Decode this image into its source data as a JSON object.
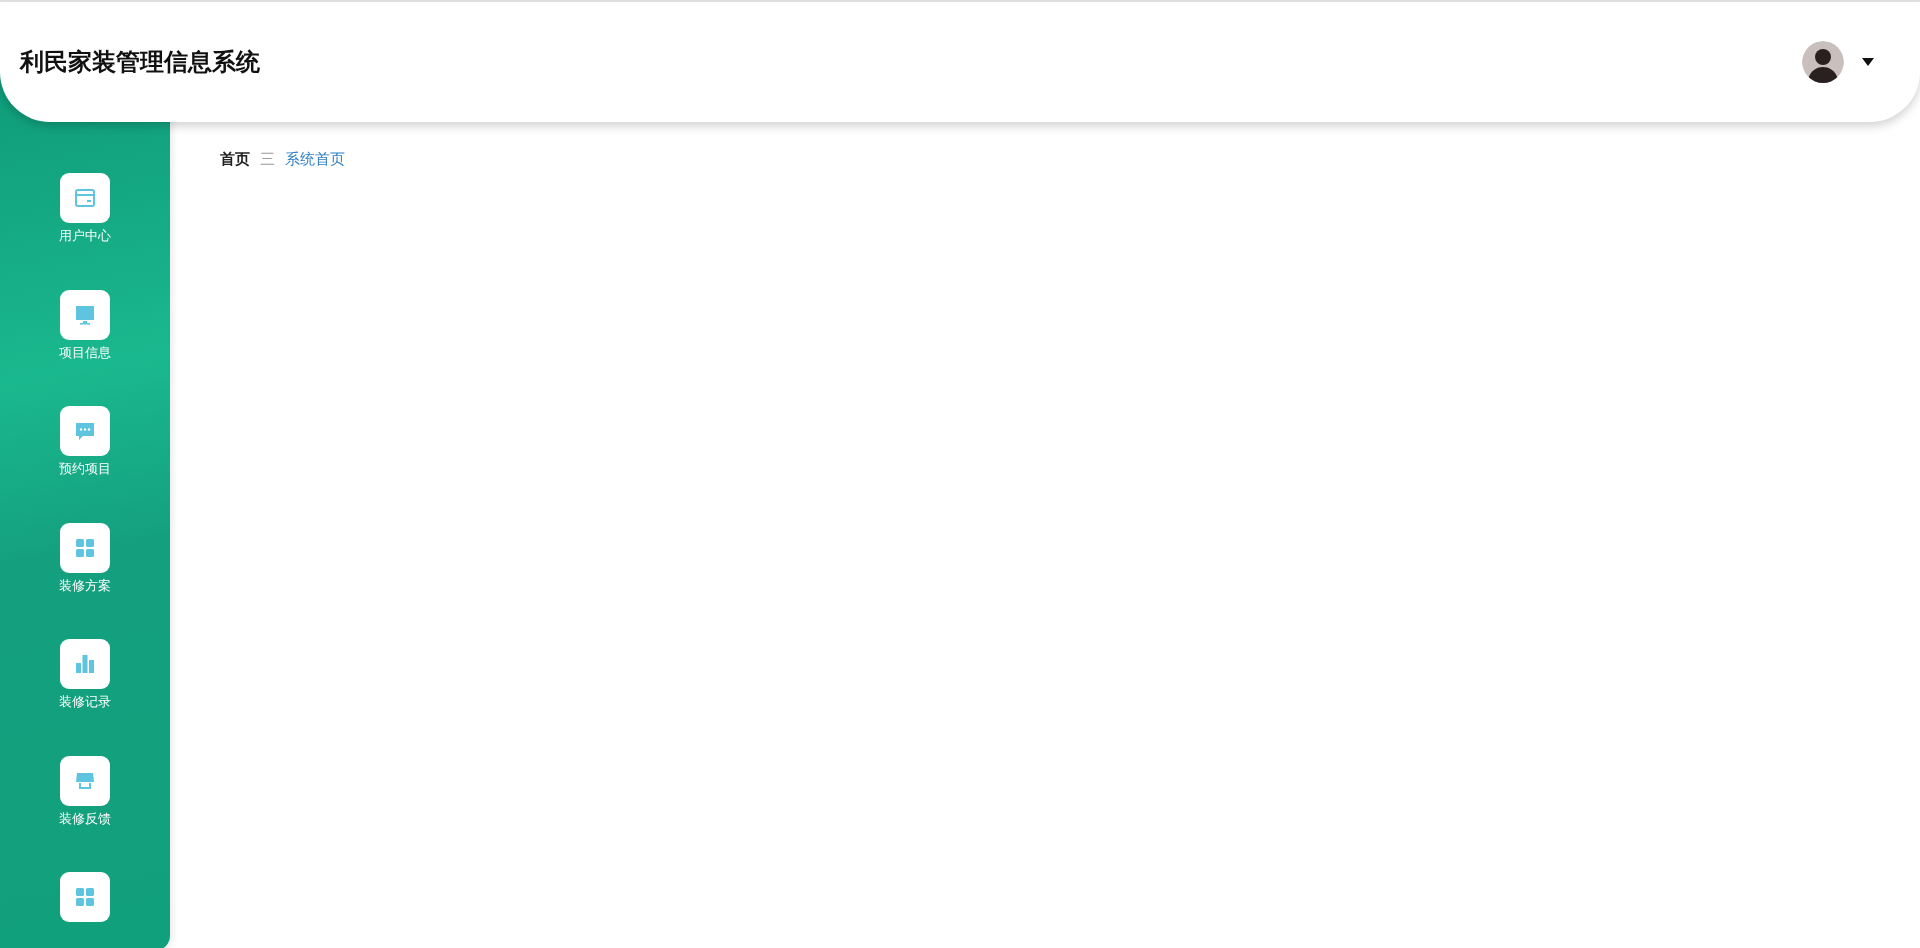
{
  "header": {
    "title": "利民家装管理信息系统"
  },
  "sidebar": {
    "items": [
      {
        "kind": "labeled",
        "label": "用户中心"
      },
      {
        "kind": "labeled",
        "label": "项目信息"
      },
      {
        "kind": "labeled",
        "label": "预约项目"
      },
      {
        "kind": "labeled",
        "label": "装修方案"
      },
      {
        "kind": "labeled",
        "label": "装修记录"
      },
      {
        "kind": "labeled",
        "label": "装修反馈"
      },
      {
        "kind": "icon_only"
      }
    ]
  },
  "breadcrumb": {
    "items": [
      "首页",
      "系统首页"
    ],
    "separator": "三"
  }
}
